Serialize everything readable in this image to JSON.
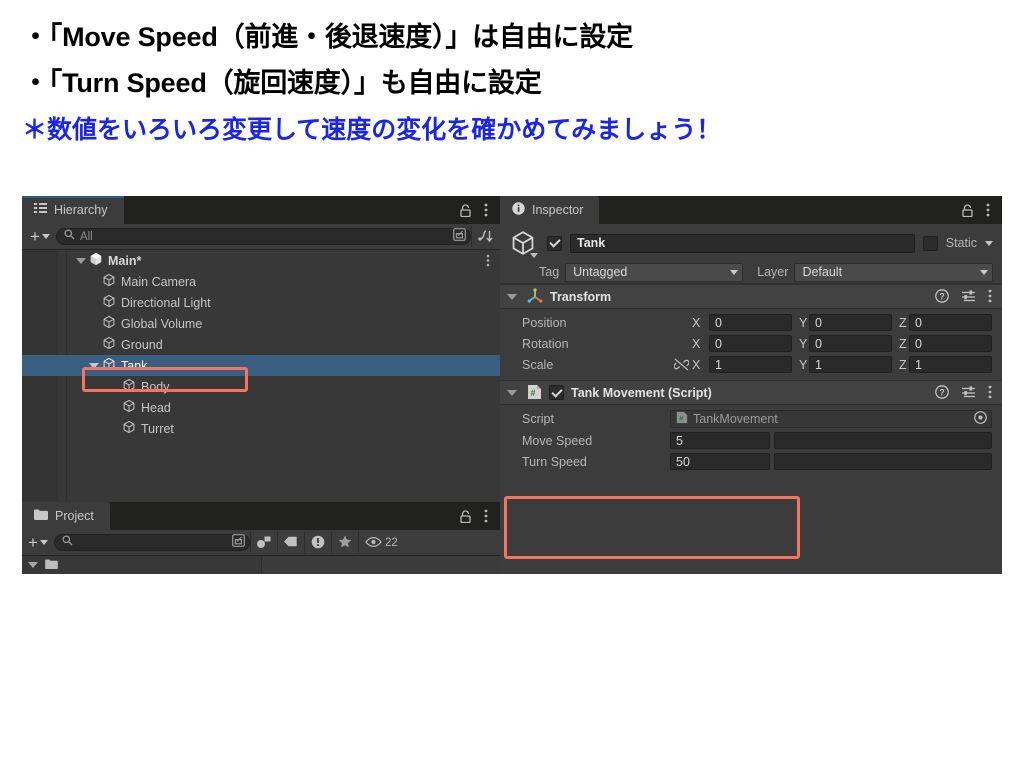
{
  "slide": {
    "bullets": [
      "・「Move Speed（前進・後退速度）」は自由に設定",
      "・「Turn Speed（旋回速度）」も自由に設定"
    ],
    "note": "＊数値をいろいろ変更して速度の変化を確かめてみましょう！",
    "note_color": "#1a25e8"
  },
  "hierarchy": {
    "tab_label": "Hierarchy",
    "tab_icon": "hierarchy-list-icon",
    "lock_icon": "lock-icon",
    "menu_icon": "kebab-menu-icon",
    "toolbar": {
      "add_label": "+",
      "search_placeholder": "All",
      "search_value": "",
      "search_icon": "search-icon",
      "expand_icon": "open-in-new-icon",
      "sort_icon": "sort-icon"
    },
    "tree": [
      {
        "label": "Main*",
        "depth": 0,
        "expanded": true,
        "selected": false,
        "root": true,
        "has_menu": true
      },
      {
        "label": "Main Camera",
        "depth": 1,
        "expanded": null,
        "selected": false,
        "root": false,
        "has_menu": false
      },
      {
        "label": "Directional Light",
        "depth": 1,
        "expanded": null,
        "selected": false,
        "root": false,
        "has_menu": false
      },
      {
        "label": "Global Volume",
        "depth": 1,
        "expanded": null,
        "selected": false,
        "root": false,
        "has_menu": false
      },
      {
        "label": "Ground",
        "depth": 1,
        "expanded": null,
        "selected": false,
        "root": false,
        "has_menu": false
      },
      {
        "label": "Tank",
        "depth": 1,
        "expanded": true,
        "selected": true,
        "root": false,
        "has_menu": false
      },
      {
        "label": "Body",
        "depth": 2,
        "expanded": null,
        "selected": false,
        "root": false,
        "has_menu": false
      },
      {
        "label": "Head",
        "depth": 2,
        "expanded": null,
        "selected": false,
        "root": false,
        "has_menu": false
      },
      {
        "label": "Turret",
        "depth": 2,
        "expanded": null,
        "selected": false,
        "root": false,
        "has_menu": false
      }
    ],
    "selection_color": "#3a5e80"
  },
  "project": {
    "tab_label": "Project",
    "tab_icon": "folder-icon",
    "lock_icon": "lock-icon",
    "menu_icon": "kebab-menu-icon",
    "toolbar": {
      "add_label": "+",
      "search_placeholder": "",
      "search_value": "",
      "search_icon": "search-icon",
      "expand_icon": "open-in-new-icon",
      "filter_type_icon": "asset-type-filter-icon",
      "filter_label_icon": "label-filter-icon",
      "filter_warning_icon": "warning-filter-icon",
      "favorite_icon": "star-icon",
      "visibility_icon": "eye-icon",
      "visibility_count": "22"
    }
  },
  "inspector": {
    "tab_label": "Inspector",
    "tab_icon": "info-icon",
    "lock_icon": "lock-icon",
    "menu_icon": "kebab-menu-icon",
    "gameobject": {
      "icon": "gameobject-cube-icon",
      "enabled": true,
      "name": "Tank",
      "static_checked": false,
      "static_label": "Static",
      "tag_label": "Tag",
      "tag_value": "Untagged",
      "layer_label": "Layer",
      "layer_value": "Default"
    },
    "components": [
      {
        "name": "Transform",
        "icon": "transform-axis-icon",
        "expanded": true,
        "has_enable_toggle": false,
        "help_icon": "help-icon",
        "preset_icon": "preset-settings-icon",
        "menu_icon": "kebab-menu-icon",
        "rows": [
          {
            "label": "Position",
            "link": false,
            "x": "0",
            "y": "0",
            "z": "0"
          },
          {
            "label": "Rotation",
            "link": false,
            "x": "0",
            "y": "0",
            "z": "0"
          },
          {
            "label": "Scale",
            "link": true,
            "link_icon": "broken-link-icon",
            "x": "1",
            "y": "1",
            "z": "1"
          }
        ],
        "axis_labels": [
          "X",
          "Y",
          "Z"
        ]
      },
      {
        "name": "Tank Movement (Script)",
        "icon": "csharp-script-icon",
        "expanded": true,
        "has_enable_toggle": true,
        "enabled": true,
        "help_icon": "help-icon",
        "preset_icon": "preset-settings-icon",
        "menu_icon": "kebab-menu-icon",
        "script_row": {
          "label": "Script",
          "value": "TankMovement",
          "value_icon": "csharp-script-icon",
          "picker_icon": "object-picker-icon"
        },
        "fields": [
          {
            "label": "Move Speed",
            "value": "5"
          },
          {
            "label": "Turn Speed",
            "value": "50"
          }
        ]
      }
    ]
  },
  "annotations": {
    "box_color": "#f4745e",
    "boxes": [
      {
        "target": "hierarchy-tank-row"
      },
      {
        "target": "inspector-speed-fields"
      }
    ]
  }
}
